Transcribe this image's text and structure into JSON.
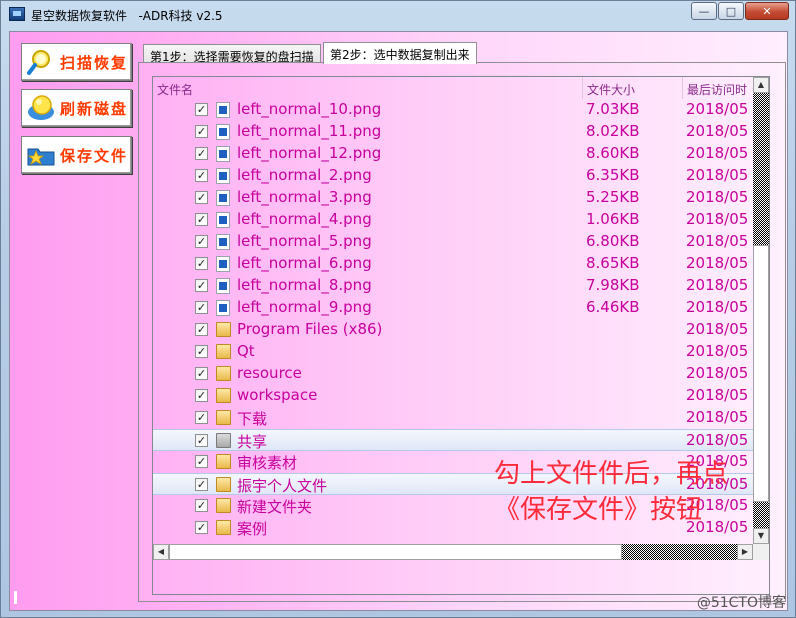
{
  "window": {
    "title": "星空数据恢复软件   -ADR科技 v2.5",
    "min_glyph": "—",
    "max_glyph": "□",
    "close_glyph": "✕"
  },
  "sidebar": {
    "buttons": [
      {
        "label": "扫描恢复",
        "icon": "magnifier-icon"
      },
      {
        "label": "刷新磁盘",
        "icon": "refresh-bulb-icon"
      },
      {
        "label": "保存文件",
        "icon": "save-folder-icon"
      }
    ]
  },
  "tabs": [
    {
      "label": "第1步：选择需要恢复的盘扫描",
      "active": false
    },
    {
      "label": "第2步：选中数据复制出来",
      "active": true
    }
  ],
  "list": {
    "columns": [
      "文件名",
      "文件大小",
      "最后访问时"
    ],
    "rows": [
      {
        "name": "left_normal_10.png",
        "size": "7.03KB",
        "date": "2018/05",
        "type": "file",
        "checked": true
      },
      {
        "name": "left_normal_11.png",
        "size": "8.02KB",
        "date": "2018/05",
        "type": "file",
        "checked": true
      },
      {
        "name": "left_normal_12.png",
        "size": "8.60KB",
        "date": "2018/05",
        "type": "file",
        "checked": true
      },
      {
        "name": "left_normal_2.png",
        "size": "6.35KB",
        "date": "2018/05",
        "type": "file",
        "checked": true
      },
      {
        "name": "left_normal_3.png",
        "size": "5.25KB",
        "date": "2018/05",
        "type": "file",
        "checked": true
      },
      {
        "name": "left_normal_4.png",
        "size": "1.06KB",
        "date": "2018/05",
        "type": "file",
        "checked": true
      },
      {
        "name": "left_normal_5.png",
        "size": "6.80KB",
        "date": "2018/05",
        "type": "file",
        "checked": true
      },
      {
        "name": "left_normal_6.png",
        "size": "8.65KB",
        "date": "2018/05",
        "type": "file",
        "checked": true
      },
      {
        "name": "left_normal_8.png",
        "size": "7.98KB",
        "date": "2018/05",
        "type": "file",
        "checked": true
      },
      {
        "name": "left_normal_9.png",
        "size": "6.46KB",
        "date": "2018/05",
        "type": "file",
        "checked": true
      },
      {
        "name": "Program Files (x86)",
        "size": "",
        "date": "2018/05",
        "type": "folder",
        "checked": true
      },
      {
        "name": "Qt",
        "size": "",
        "date": "2018/05",
        "type": "folder",
        "checked": true
      },
      {
        "name": "resource",
        "size": "",
        "date": "2018/05",
        "type": "folder",
        "checked": true
      },
      {
        "name": "workspace",
        "size": "",
        "date": "2018/05",
        "type": "folder",
        "checked": true
      },
      {
        "name": "下载",
        "size": "",
        "date": "2018/05",
        "type": "folder",
        "checked": true
      },
      {
        "name": "共享",
        "size": "",
        "date": "2018/05",
        "type": "folder-shared",
        "checked": true,
        "selected": true
      },
      {
        "name": "审核素材",
        "size": "",
        "date": "2018/05",
        "type": "folder",
        "checked": true
      },
      {
        "name": "振宇个人文件",
        "size": "",
        "date": "2018/05",
        "type": "folder",
        "checked": true,
        "hover": true
      },
      {
        "name": "新建文件夹",
        "size": "",
        "date": "2018/05",
        "type": "folder",
        "checked": true
      },
      {
        "name": "案例",
        "size": "",
        "date": "2018/05",
        "type": "folder",
        "checked": true
      }
    ]
  },
  "annotation": {
    "line1": "勾上文件件后，再点",
    "line2": "《保存文件》按钮"
  },
  "watermark": "@51CTO博客",
  "checkbox_glyph": "✓"
}
